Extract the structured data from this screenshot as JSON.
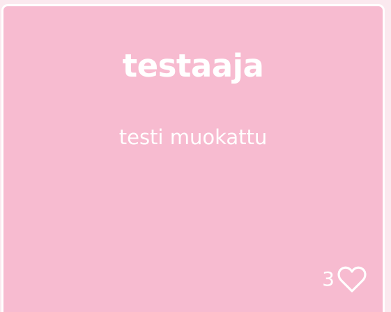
{
  "card": {
    "title": "testaaja",
    "message": "testi muokattu",
    "likes": {
      "count": "3",
      "icon": "heart-outline-icon"
    }
  },
  "colors": {
    "page_background": "#fbe9ef",
    "card_background": "#f7bbd0",
    "card_border": "#ffffff",
    "text": "#ffffff"
  }
}
